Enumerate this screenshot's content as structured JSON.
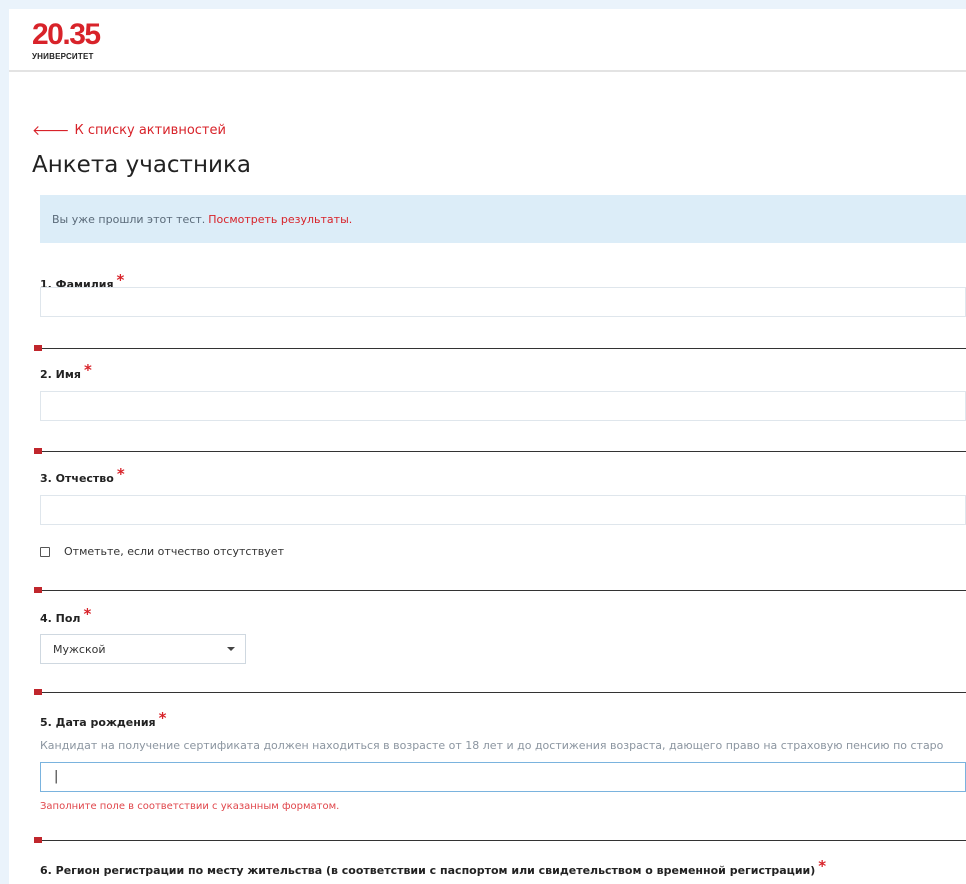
{
  "header": {
    "logo_number": "20.35",
    "logo_subtitle": "УНИВЕРСИТЕТ"
  },
  "nav": {
    "back_link": "К списку активностей",
    "back_icon": "arrow-left-icon"
  },
  "page": {
    "title": "Анкета участника"
  },
  "info": {
    "text": "Вы уже прошли этот тест.",
    "link": "Посмотреть результаты."
  },
  "questions": [
    {
      "label": "1. Фамилия",
      "required": "*",
      "value": ""
    },
    {
      "label": "2. Имя",
      "required": "*",
      "value": ""
    },
    {
      "label": "3. Отчество",
      "required": "*",
      "value": "",
      "checkbox_label": "Отметьте, если отчество отсутствует"
    },
    {
      "label": "4. Пол",
      "required": "*",
      "selected": "Мужской"
    },
    {
      "label": "5. Дата рождения",
      "required": "*",
      "hint": "Кандидат на получение сертификата должен находиться в возрасте от 18 лет и до достижения возраста, дающего право на страховую пенсию по старо",
      "value": "|",
      "error": "Заполните поле в соответствии с указанным форматом."
    },
    {
      "label": "6. Регион регистрации по месту жительства (в соответствии с паспортом или свидетельством о временной регистрации)",
      "required": "*"
    }
  ],
  "colors": {
    "accent": "#d8232a",
    "info_bg": "#dcedf8",
    "page_bg": "#eaf3fb"
  }
}
